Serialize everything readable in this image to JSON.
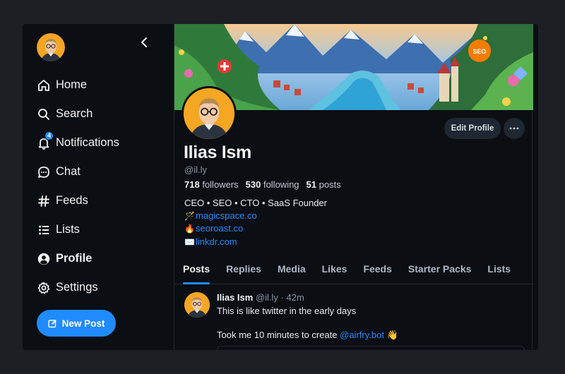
{
  "sidebar": {
    "items": [
      {
        "label": "Home",
        "icon": "home-icon"
      },
      {
        "label": "Search",
        "icon": "search-icon"
      },
      {
        "label": "Notifications",
        "icon": "bell-icon",
        "badge": "4"
      },
      {
        "label": "Chat",
        "icon": "chat-icon"
      },
      {
        "label": "Feeds",
        "icon": "hash-icon"
      },
      {
        "label": "Lists",
        "icon": "list-icon"
      },
      {
        "label": "Profile",
        "icon": "user-icon",
        "active": true
      },
      {
        "label": "Settings",
        "icon": "gear-icon"
      }
    ],
    "new_post_label": "New Post"
  },
  "profile": {
    "banner_badge": "SEO",
    "edit_profile_label": "Edit Profile",
    "more_label": "···",
    "name": "Ilias Ism",
    "handle": "@il.ly",
    "stats": {
      "followers_count": "718",
      "followers_label": "followers",
      "following_count": "530",
      "following_label": "following",
      "posts_count": "51",
      "posts_label": "posts"
    },
    "bio": {
      "line1": "CEO • SEO • CTO • SaaS Founder",
      "links": [
        {
          "emoji": "🪄",
          "text": "magicspace.co"
        },
        {
          "emoji": "🔥",
          "text": "seoroast.co"
        },
        {
          "emoji": "✉️",
          "text": "linkdr.com"
        }
      ]
    }
  },
  "tabs": [
    "Posts",
    "Replies",
    "Media",
    "Likes",
    "Feeds",
    "Starter Packs",
    "Lists"
  ],
  "active_tab": "Posts",
  "post": {
    "author": "Ilias Ism",
    "handle": "@il.ly",
    "separator": "·",
    "time": "42m",
    "text_line1": "This is like twitter in the early days",
    "text_line2_prefix": "Took me 10 minutes to create ",
    "mention": "@airfry.bot",
    "text_line2_suffix": " 👋"
  },
  "colors": {
    "accent": "#208bfe",
    "background": "#0b0e13",
    "avatar_bg": "#f5a623"
  }
}
